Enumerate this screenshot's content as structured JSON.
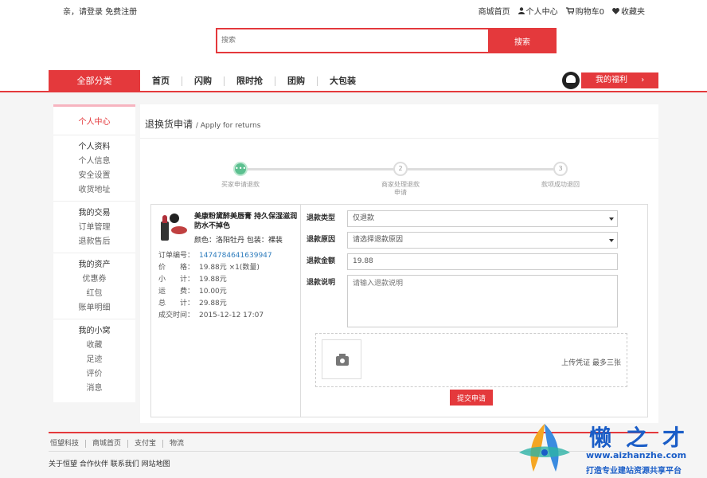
{
  "topbar": {
    "greeting": "亲，请登录",
    "register": "免费注册",
    "links": [
      {
        "icon": "none",
        "label": "商城首页"
      },
      {
        "icon": "user-icon",
        "label": "个人中心"
      },
      {
        "icon": "cart-icon",
        "label": "购物车0"
      },
      {
        "icon": "heart-icon",
        "label": "收藏夹"
      }
    ]
  },
  "search": {
    "placeholder": "搜索",
    "button": "搜索"
  },
  "nav": {
    "all_categories": "全部分类",
    "items": [
      "首页",
      "闪购",
      "限时抢",
      "团购",
      "大包装"
    ],
    "welfare": "我的福利"
  },
  "sidebar": {
    "title": "个人中心",
    "groups": [
      {
        "head": "个人资料",
        "items": [
          "个人信息",
          "安全设置",
          "收货地址"
        ]
      },
      {
        "head": "我的交易",
        "items": [
          "订单管理",
          "退款售后"
        ]
      },
      {
        "head": "我的资产",
        "items": [
          "优惠券",
          "红包",
          "账单明细"
        ]
      },
      {
        "head": "我的小窝",
        "items": [
          "收藏",
          "足迹",
          "评价",
          "消息"
        ]
      }
    ]
  },
  "page": {
    "title": "退换货申请",
    "title_en": "/ Apply for returns"
  },
  "steps": [
    {
      "mark": "•••",
      "label": "买家申请退款"
    },
    {
      "mark": "2",
      "label": "商家处理退款申请"
    },
    {
      "mark": "3",
      "label": "款项成功退回"
    }
  ],
  "product": {
    "name": "美康粉黛醉美唇膏 持久保湿滋润防水不掉色",
    "spec": "颜色：洛阳牡丹 包装：裸装"
  },
  "order_info": [
    {
      "label": "订单编号：",
      "value": "1474784641639947",
      "link": true
    },
    {
      "label": "价　　格：",
      "value": "19.88元 ×1(数量)"
    },
    {
      "label": "小　　计：",
      "value": "19.88元"
    },
    {
      "label": "运　　费：",
      "value": "10.00元"
    },
    {
      "label": "总　　计：",
      "value": "29.88元"
    },
    {
      "label": "成交时间：",
      "value": "2015-12-12 17:07"
    }
  ],
  "form": {
    "type_label": "退款类型",
    "type_value": "仅退款",
    "reason_label": "退款原因",
    "reason_value": "请选择退款原因",
    "amount_label": "退款金额",
    "amount_value": "19.88",
    "desc_label": "退款说明",
    "desc_placeholder": "请输入退款说明",
    "upload_text": "上传凭证 最多三张",
    "submit": "提交申请"
  },
  "footer": {
    "links": [
      "恒望科技",
      "商城首页",
      "支付宝",
      "物流"
    ],
    "info": "关于恒望 合作伙伴 联系我们 网站地图"
  },
  "watermark": {
    "brand": "懒之才",
    "url": "www.aizhanzhe.com",
    "slogan": "打造专业建站资源共享平台"
  }
}
